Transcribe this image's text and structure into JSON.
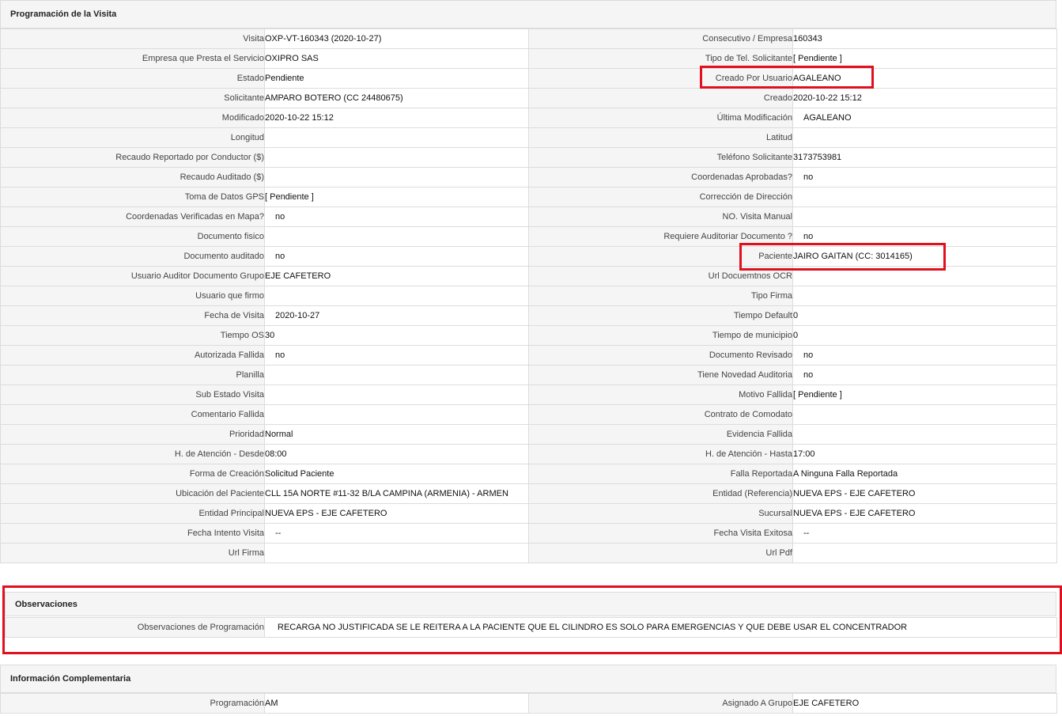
{
  "sections": {
    "programacion": "Programación de la Visita",
    "observaciones": "Observaciones",
    "complementaria": "Información Complementaria"
  },
  "rows": [
    {
      "l1": "Visita",
      "v1": "OXP-VT-160343 (2020-10-27)",
      "l2": "Consecutivo / Empresa",
      "v2": "160343"
    },
    {
      "l1": "Empresa que Presta el Servicio",
      "v1": "OXIPRO SAS",
      "l2": "Tipo de Tel. Solicitante",
      "v2": "[ Pendiente ]"
    },
    {
      "l1": "Estado",
      "v1": "Pendiente",
      "l2": "Creado Por Usuario",
      "v2": "AGALEANO"
    },
    {
      "l1": "Solicitante",
      "v1": "AMPARO BOTERO (CC 24480675)",
      "l2": "Creado",
      "v2": "2020-10-22 15:12"
    },
    {
      "l1": "Modificado",
      "v1": "2020-10-22 15:12",
      "l2": "Última Modificación",
      "v2": "AGALEANO"
    },
    {
      "l1": "Longitud",
      "v1": "",
      "l2": "Latitud",
      "v2": ""
    },
    {
      "l1": "Recaudo Reportado por Conductor ($)",
      "v1": "",
      "l2": "Teléfono Solicitante",
      "v2": "3173753981"
    },
    {
      "l1": "Recaudo Auditado ($)",
      "v1": "",
      "l2": "Coordenadas Aprobadas?",
      "v2": "no"
    },
    {
      "l1": "Toma de Datos GPS",
      "v1": "[ Pendiente ]",
      "l2": "Corrección de Dirección",
      "v2": ""
    },
    {
      "l1": "Coordenadas Verificadas en Mapa?",
      "v1": "no",
      "l2": "NO. Visita Manual",
      "v2": ""
    },
    {
      "l1": "Documento fisico",
      "v1": "",
      "l2": "Requiere Auditoriar Documento ?",
      "v2": "no"
    },
    {
      "l1": "Documento auditado",
      "v1": "no",
      "l2": "Paciente",
      "v2": "JAIRO GAITAN (CC: 3014165)"
    },
    {
      "l1": "Usuario Auditor Documento Grupo",
      "v1": "EJE CAFETERO",
      "l2": "Url Docuemtnos OCR",
      "v2": ""
    },
    {
      "l1": "Usuario que firmo",
      "v1": "",
      "l2": "Tipo Firma",
      "v2": ""
    },
    {
      "l1": "Fecha de Visita",
      "v1": "2020-10-27",
      "l2": "Tiempo Default",
      "v2": "0"
    },
    {
      "l1": "Tiempo OS",
      "v1": "30",
      "l2": "Tiempo de municipio",
      "v2": "0"
    },
    {
      "l1": "Autorizada Fallida",
      "v1": "no",
      "l2": "Documento Revisado",
      "v2": "no"
    },
    {
      "l1": "Planilla",
      "v1": "",
      "l2": "Tiene Novedad Auditoria",
      "v2": "no"
    },
    {
      "l1": "Sub Estado Visita",
      "v1": "",
      "l2": "Motivo Fallida",
      "v2": "[ Pendiente ]"
    },
    {
      "l1": "Comentario Fallida",
      "v1": "",
      "l2": "Contrato de Comodato",
      "v2": ""
    },
    {
      "l1": "Prioridad",
      "v1": "Normal",
      "l2": "Evidencia Fallida",
      "v2": ""
    },
    {
      "l1": "H. de Atención - Desde",
      "v1": "08:00",
      "l2": "H. de Atención - Hasta",
      "v2": "17:00"
    },
    {
      "l1": "Forma de Creación",
      "v1": "Solicitud Paciente",
      "l2": "Falla Reportada",
      "v2": "A Ninguna Falla Reportada"
    },
    {
      "l1": "Ubicación del Paciente",
      "v1": "CLL 15A NORTE #11-32 B/LA CAMPINA (ARMENIA) - ARMEN",
      "l2": "Entidad (Referencia)",
      "v2": "NUEVA EPS - EJE CAFETERO"
    },
    {
      "l1": "Entidad Principal",
      "v1": "NUEVA EPS - EJE CAFETERO",
      "l2": "Sucursal",
      "v2": "NUEVA EPS - EJE CAFETERO"
    },
    {
      "l1": "Fecha Intento Visita",
      "v1": "--",
      "l2": "Fecha Visita Exitosa",
      "v2": "--"
    },
    {
      "l1": "Url Firma",
      "v1": "",
      "l2": "Url Pdf",
      "v2": ""
    }
  ],
  "observaciones": {
    "label": "Observaciones de Programación",
    "value": "RECARGA NO JUSTIFICADA SE LE REITERA A LA PACIENTE QUE EL CILINDRO ES SOLO PARA EMERGENCIAS Y QUE DEBE USAR EL CONCENTRADOR"
  },
  "complementaria_rows": [
    {
      "l1": "Programación",
      "v1": "AM",
      "l2": "Asignado A Grupo",
      "v2": "EJE CAFETERO"
    }
  ],
  "colors": {
    "highlight": "#e0101e",
    "label_bg": "#f5f5f5",
    "border": "#dcdcdc"
  }
}
